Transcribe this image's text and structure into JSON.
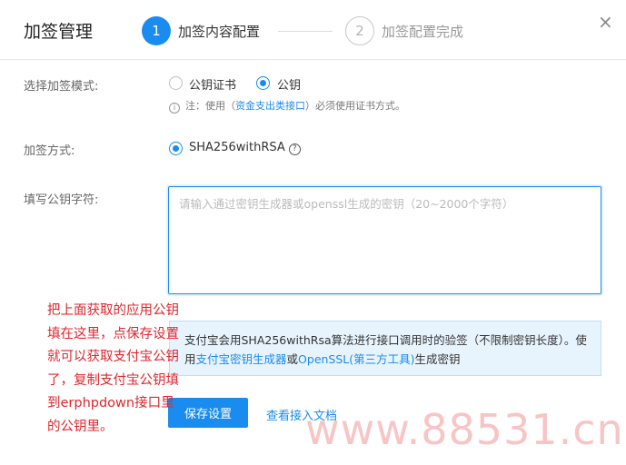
{
  "header": {
    "title": "加签管理",
    "steps": [
      {
        "number": "1",
        "label": "加签内容配置",
        "active": true
      },
      {
        "number": "2",
        "label": "加签配置完成",
        "active": false
      }
    ],
    "close_icon": "×"
  },
  "mode": {
    "label": "选择加签模式:",
    "options": [
      "公钥证书",
      "公钥"
    ],
    "selected": "公钥",
    "note_prefix": "注：使用（",
    "note_link": "资金支出类接口",
    "note_suffix": "）必须使用证书方式。"
  },
  "sign_method": {
    "label": "加签方式:",
    "value": "SHA256withRSA"
  },
  "public_key": {
    "label": "填写公钥字符:",
    "value": "",
    "placeholder": "请输入通过密钥生成器或openssl生成的密钥（20~2000个字符）"
  },
  "info": {
    "text1": "支付宝会用SHA256withRsa算法进行接口调用时的验签（不限制密钥长度）。使用",
    "link1": "支付宝密钥生成器",
    "text2": "或",
    "link2": "OpenSSL(第三方工具)",
    "text3": "生成密钥"
  },
  "actions": {
    "save_label": "保存设置",
    "doc_link": "查看接入文档"
  },
  "annotation": {
    "lines": [
      "把上面获取的应用公钥",
      "填在这里，点保存设置",
      "就可以获取支付宝公钥",
      "了，复制支付宝公钥填",
      "到erphpdown接口里",
      "的公钥里。"
    ]
  },
  "watermark": "www.88531.cn",
  "colors": {
    "primary": "#1a8cf0",
    "info_bg": "#e8f4fd",
    "annotation": "#e0262c"
  }
}
